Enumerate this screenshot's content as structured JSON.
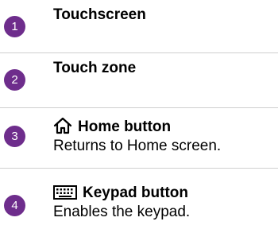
{
  "theme": {
    "badge_color": "#6e2d8c",
    "divider_color": "#cfcfcf"
  },
  "items": [
    {
      "number": "1",
      "title": "Touchscreen",
      "icon": null,
      "description": ""
    },
    {
      "number": "2",
      "title": "Touch zone",
      "icon": null,
      "description": ""
    },
    {
      "number": "3",
      "title": "Home button",
      "icon": "home-icon",
      "description": "Returns to Home screen."
    },
    {
      "number": "4",
      "title": "Keypad button",
      "icon": "keypad-icon",
      "description": "Enables the keypad."
    }
  ]
}
